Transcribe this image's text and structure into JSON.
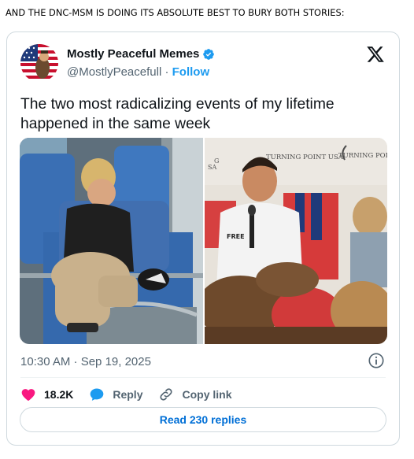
{
  "headline": "AND THE DNC-MSM IS DOING ITS ABSOLUTE BEST TO BURY BOTH STORIES:",
  "tweet": {
    "author_name": "Mostly Peaceful Memes",
    "handle": "@MostlyPeacefull",
    "separator": " · ",
    "follow_label": "Follow",
    "text": "The two most radicalizing events of my lifetime happened in the same week",
    "timestamp": "10:30 AM · Sep 19, 2025",
    "icons": {
      "verified": "verified-badge-icon",
      "platform": "x-logo-icon",
      "info": "info-icon",
      "like": "heart-icon",
      "reply": "speech-bubble-icon",
      "copy": "link-icon"
    },
    "media": {
      "right_photo_signage": "TURNING POINT USA",
      "right_shirt_text": "FREE"
    }
  },
  "actions": {
    "like_count": "18.2K",
    "reply_label": "Reply",
    "copy_link_label": "Copy link"
  },
  "read_replies_label": "Read 230 replies",
  "colors": {
    "accent_blue": "#1d9bf0",
    "like_pink": "#f91880",
    "text_primary": "#0f1419",
    "text_secondary": "#536471",
    "border": "#cfd9de",
    "link_blue": "#006fd6"
  }
}
